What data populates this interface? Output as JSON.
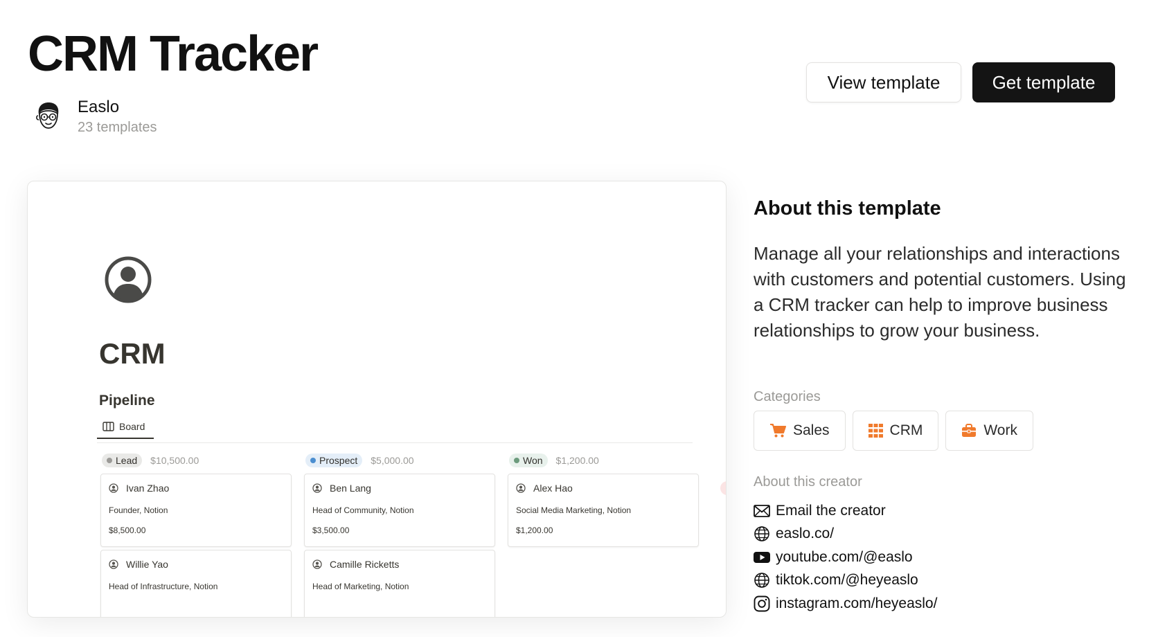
{
  "header": {
    "title": "CRM Tracker",
    "creator_name": "Easlo",
    "creator_templates": "23 templates",
    "view_button": "View template",
    "get_button": "Get template"
  },
  "preview": {
    "page_title": "CRM",
    "section_title": "Pipeline",
    "view_tab": "Board",
    "columns": [
      {
        "status": "Lead",
        "status_color": "#9b9a97",
        "pill_bg": "#e9e9e7",
        "total": "$10,500.00",
        "cards": [
          {
            "name": "Ivan Zhao",
            "role": "Founder, Notion",
            "amount": "$8,500.00"
          },
          {
            "name": "Willie Yao",
            "role": "Head of Infrastructure, Notion",
            "amount": ""
          }
        ]
      },
      {
        "status": "Prospect",
        "status_color": "#4b8ed0",
        "pill_bg": "#e4eef8",
        "total": "$5,000.00",
        "cards": [
          {
            "name": "Ben Lang",
            "role": "Head of Community, Notion",
            "amount": "$3,500.00"
          },
          {
            "name": "Camille Ricketts",
            "role": "Head of Marketing, Notion",
            "amount": ""
          }
        ]
      },
      {
        "status": "Won",
        "status_color": "#6c9b7d",
        "pill_bg": "#e8f1ec",
        "total": "$1,200.00",
        "cards": [
          {
            "name": "Alex Hao",
            "role": "Social Media Marketing, Notion",
            "amount": "$1,200.00"
          }
        ]
      }
    ]
  },
  "about": {
    "title": "About this template",
    "description": "Manage all your relationships and interactions with customers and potential customers. Using a CRM tracker can help to improve business relationships to grow your business.",
    "categories_label": "Categories",
    "categories": [
      {
        "label": "Sales",
        "icon": "cart-icon"
      },
      {
        "label": "CRM",
        "icon": "grid-icon"
      },
      {
        "label": "Work",
        "icon": "briefcase-icon"
      }
    ],
    "creator_label": "About this creator",
    "links": [
      {
        "label": "Email the creator",
        "icon": "mail-icon"
      },
      {
        "label": "easlo.co/",
        "icon": "globe-icon"
      },
      {
        "label": "youtube.com/@easlo",
        "icon": "youtube-icon"
      },
      {
        "label": "tiktok.com/@heyeaslo",
        "icon": "globe-icon"
      },
      {
        "label": "instagram.com/heyeaslo/",
        "icon": "instagram-icon"
      }
    ]
  },
  "colors": {
    "accent_orange": "#f07a2c",
    "primary_button": "#141414"
  }
}
